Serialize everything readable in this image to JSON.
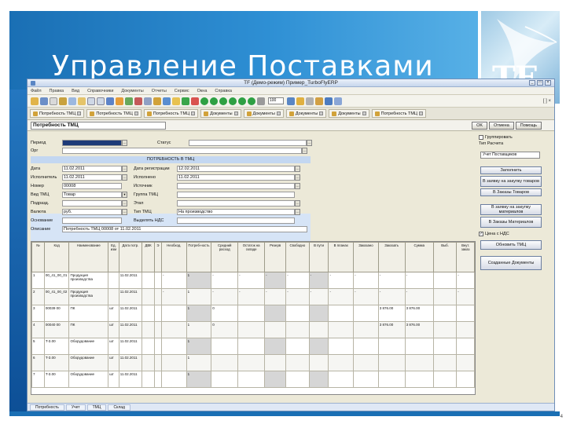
{
  "slide": {
    "title": "Управление Поставками",
    "logo_text": "TF",
    "page_number": "4",
    "colors": {
      "band": "#1a6fb4",
      "accent": "#57b0e6"
    }
  },
  "window": {
    "title": "TF (Демо-режим) Пример_TurboFlyERP",
    "menu": [
      "Файл",
      "Правка",
      "Вид",
      "Справочники",
      "Документы",
      "Отчеты",
      "Сервис",
      "Окна",
      "Справка"
    ],
    "toolbar_select": "100",
    "toolbar_right": "[ ] ×"
  },
  "tabs": [
    "Потребность ТМЦ",
    "Потребность ТМЦ",
    "Потребность ТМЦ",
    "Документы",
    "Документы",
    "Документы",
    "Документы",
    "Потребность ТМЦ",
    "Документы"
  ],
  "doc": {
    "title": "Потребность ТМЦ",
    "buttons": {
      "ok": "OK",
      "cancel": "Отмена",
      "help": "Помощь"
    }
  },
  "form": {
    "period_label": "Период",
    "period_value": "",
    "status_label": "Статус",
    "org_label": "Орг",
    "band_title": "ПОТРЕБНОСТЬ В ТМЦ",
    "date_label": "Дата",
    "date_value": "11.02.2011",
    "date_registered_label": "Дата регистрации",
    "date_registered_value": "12.02.2011",
    "executed_label": "Исполнено",
    "executed_value": "11.02.2011",
    "executed_by_label": "Исполнитель",
    "executed_by_value": "11.02.2011",
    "number_label": "Номер",
    "number_value": "00008",
    "source_label": "Источник",
    "request_label": "Вид ТМЦ",
    "request_value": "Товар",
    "group_label": "Группа ТМЦ",
    "division_label": "Подразд.",
    "division_value": "",
    "state_label": "Этап",
    "currency_label": "Валюта",
    "currency_value": "руб.",
    "type_label": "Тип ТМЦ",
    "type_value": "На производство",
    "reason_label": "Основание",
    "vat_label": "Выделять НДС",
    "comment_label": "Описание",
    "comment_value": "Потребность ТМЦ 00008 от 11.02.2011"
  },
  "grid": {
    "columns": [
      "№",
      "Код",
      "Наименование",
      "Ед. изм",
      "Дата потр.",
      "ДВК",
      "Э",
      "Необход.",
      "Потреб-ность",
      "Средний расход",
      "Остаток на складе",
      "Резерв",
      "Свободно",
      "В пути",
      "В планах",
      "Заказано",
      "Заказать",
      "Сумма",
      "Выб.",
      "Внут. заказ"
    ],
    "rows": [
      {
        "n": "1",
        "code": "00_41_00_01",
        "name": "Продукция производства",
        "unit": "",
        "date": "11.02.2011",
        "need": "1",
        "qty": "-",
        "sum": "-"
      },
      {
        "n": "2",
        "code": "00_41_00_02",
        "name": "Продукция производства",
        "unit": "",
        "date": "11.02.2011",
        "need": "1",
        "qty": "-",
        "sum": "-"
      },
      {
        "n": "3",
        "code": "00039 00",
        "name": "ПК",
        "unit": "шт",
        "date": "11.02.2011",
        "need": "1",
        "qty": "0",
        "sum": "3 876.00"
      },
      {
        "n": "4",
        "code": "00040 00",
        "name": "ПК",
        "unit": "шт",
        "date": "11.02.2011",
        "need": "1",
        "qty": "0",
        "sum": "3 876.00"
      },
      {
        "n": "5",
        "code": "T-3.00",
        "name": "Оборудование",
        "unit": "шт",
        "date": "11.02.2011",
        "need": "1",
        "qty": "-",
        "sum": "-"
      },
      {
        "n": "6",
        "code": "T-3.00",
        "name": "Оборудование",
        "unit": "шт",
        "date": "11.02.2011",
        "need": "1",
        "qty": "-",
        "sum": "-"
      },
      {
        "n": "7",
        "code": "T-3.00",
        "name": "Оборудование",
        "unit": "шт",
        "date": "11.02.2011",
        "need": "1",
        "qty": "-",
        "sum": "-"
      }
    ]
  },
  "right_panel": {
    "cb_group": "Группировать",
    "cb_calc_type": "Тип Расчета",
    "calc_select": "Учет Поставщиков",
    "btn_fill": "Заполнить",
    "btn_purchase_request": "В заявку на закупку товаров",
    "btn_goods_orders": "В Заказы Товаров",
    "btn_material_request": "В заявку на закупку материалов",
    "btn_material_orders": "В Заказы Материалов",
    "cb_price_vat": "Цена с НДС",
    "btn_refresh": "Обновить ТМЦ",
    "btn_created_docs": "Созданные Документы"
  },
  "status": {
    "tabs": [
      "Потребность",
      "Учет",
      "ТМЦ",
      "Склад"
    ]
  }
}
